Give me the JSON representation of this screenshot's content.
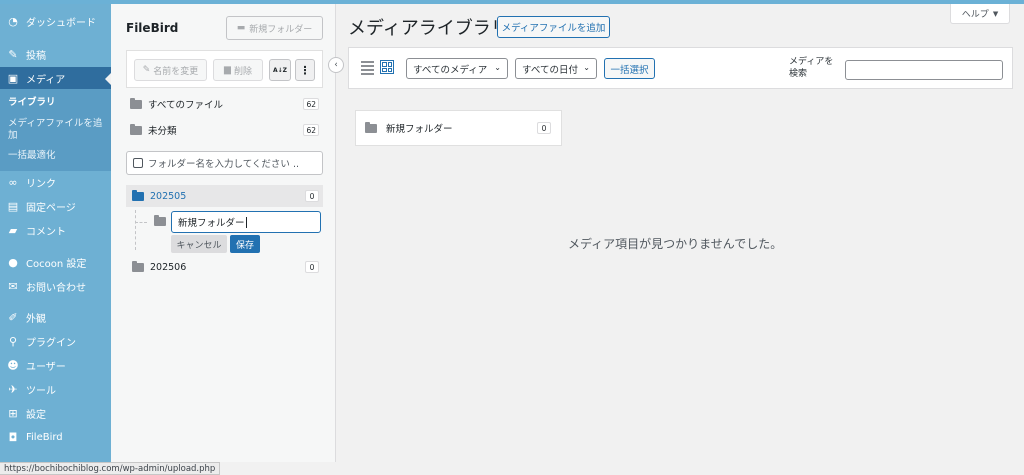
{
  "admin_menu": {
    "items": [
      {
        "label": "ダッシュボード",
        "icon": "dashboard-icon"
      },
      {
        "label": "投稿",
        "icon": "pin-icon"
      },
      {
        "label": "メディア",
        "icon": "media-icon"
      },
      {
        "label": "リンク",
        "icon": "link-icon"
      },
      {
        "label": "固定ページ",
        "icon": "page-icon"
      },
      {
        "label": "コメント",
        "icon": "comment-icon"
      },
      {
        "label": "Cocoon 設定",
        "icon": "cocoon-icon"
      },
      {
        "label": "お問い合わせ",
        "icon": "mail-icon"
      },
      {
        "label": "外観",
        "icon": "brush-icon"
      },
      {
        "label": "プラグイン",
        "icon": "plugin-icon"
      },
      {
        "label": "ユーザー",
        "icon": "user-icon"
      },
      {
        "label": "ツール",
        "icon": "wrench-icon"
      },
      {
        "label": "設定",
        "icon": "settings-icon"
      },
      {
        "label": "FileBird",
        "icon": "filebird-icon"
      }
    ],
    "media_submenu": [
      {
        "label": "ライブラリ"
      },
      {
        "label": "メディアファイルを追加"
      },
      {
        "label": "一括最適化"
      }
    ]
  },
  "filebird": {
    "title": "FileBird",
    "new_folder": "新規フォルダー",
    "rename": "名前を変更",
    "delete": "削除",
    "sort": "A↓Z",
    "all_files": {
      "label": "すべてのファイル",
      "count": "62"
    },
    "uncategorized": {
      "label": "未分類",
      "count": "62"
    },
    "search_placeholder": "フォルダー名を入力してください ..",
    "folders": [
      {
        "label": "202505",
        "count": "0"
      },
      {
        "label": "202506",
        "count": "0"
      }
    ],
    "rename_input_value": "新規フォルダー",
    "cancel": "キャンセル",
    "save": "保存"
  },
  "main": {
    "title": "メディアライブラリ",
    "add_media": "メディアファイルを追加",
    "help": "ヘルプ",
    "filter_media": "すべてのメディア",
    "filter_dates": "すべての日付",
    "bulk_select": "一括選択",
    "search_label": "メディアを検索",
    "folder_card": {
      "label": "新規フォルダー",
      "count": "0"
    },
    "empty_message": "メディア項目が見つかりませんでした。"
  },
  "status_url": "https://bochibochiblog.com/wp-admin/upload.php",
  "colors": {
    "admin_sidebar": "#6eb0d3",
    "accent": "#2271b1"
  }
}
